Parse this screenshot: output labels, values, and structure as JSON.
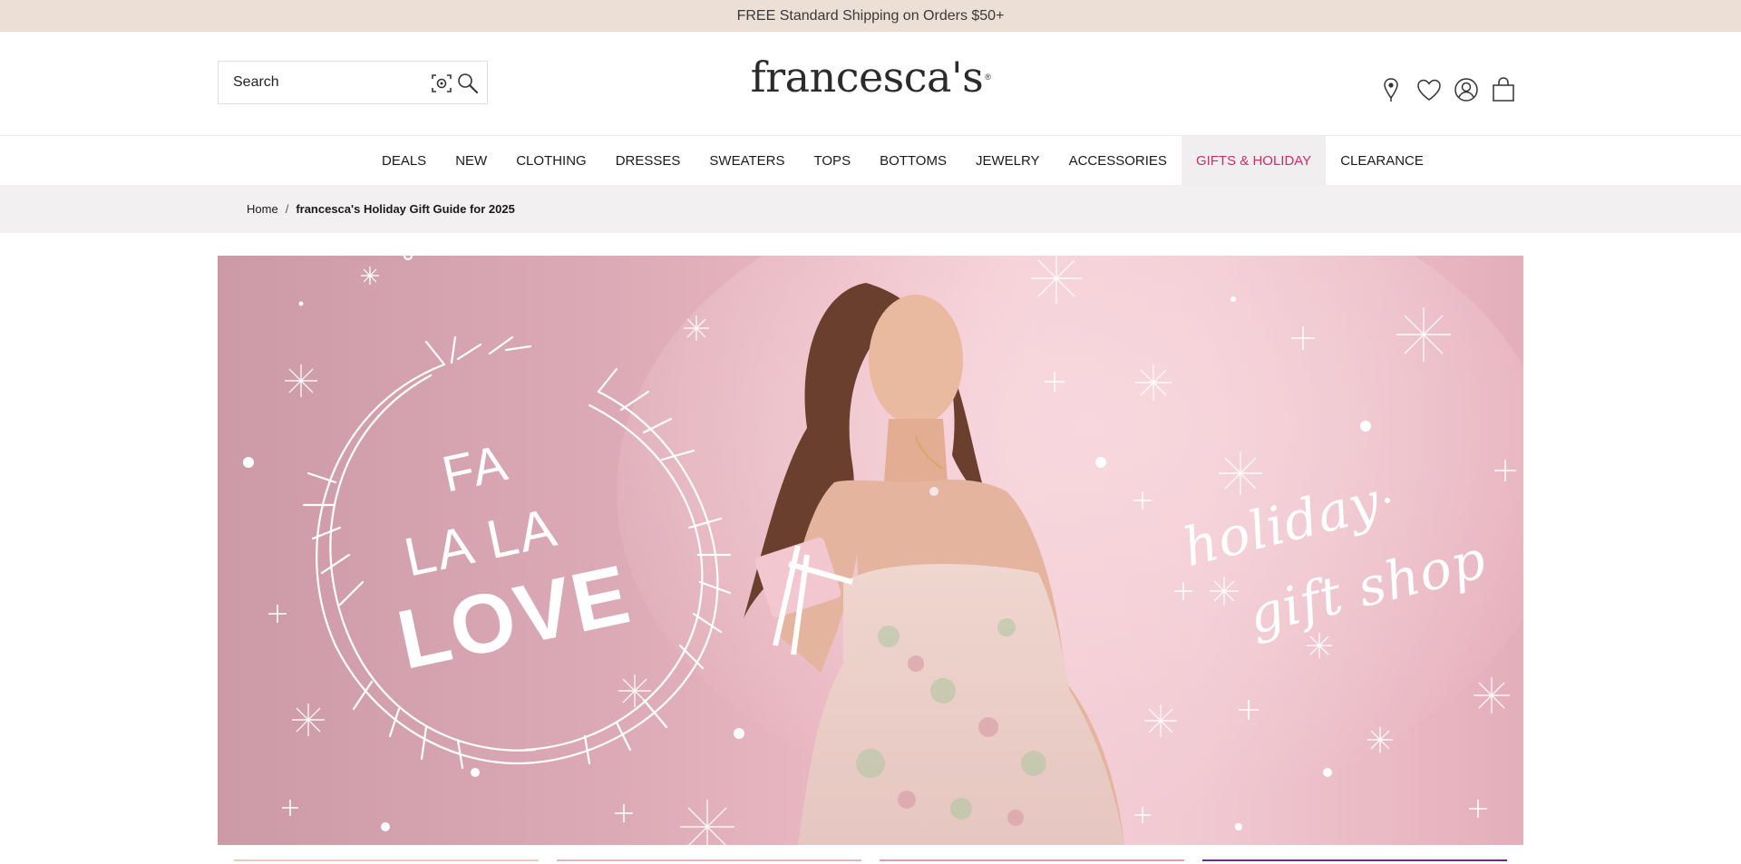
{
  "promo": {
    "text": "FREE Standard Shipping on Orders $50+"
  },
  "header": {
    "search_placeholder": "Search",
    "logo_text": "francesca's",
    "icons": [
      "location-pin-icon",
      "heart-icon",
      "account-icon",
      "shopping-bag-icon"
    ]
  },
  "nav": {
    "items": [
      {
        "label": "DEALS"
      },
      {
        "label": "NEW"
      },
      {
        "label": "CLOTHING"
      },
      {
        "label": "DRESSES"
      },
      {
        "label": "SWEATERS"
      },
      {
        "label": "TOPS"
      },
      {
        "label": "BOTTOMS"
      },
      {
        "label": "JEWELRY"
      },
      {
        "label": "ACCESSORIES"
      },
      {
        "label": "GIFTS & HOLIDAY",
        "active": true
      },
      {
        "label": "CLEARANCE"
      }
    ]
  },
  "breadcrumb": {
    "home": "Home",
    "separator": "/",
    "current": "francesca's Holiday Gift Guide for 2025"
  },
  "hero": {
    "line1": "FA",
    "line2": "LA LA",
    "line3": "LOVE",
    "script_line1": "holiday",
    "script_line2": "gift shop"
  },
  "colors": {
    "promo_bg": "#ecdfd5",
    "accent": "#cf2a6a",
    "breadcrumb_bg": "#f2f0f1",
    "hero_pink": "#e9b7c2"
  }
}
